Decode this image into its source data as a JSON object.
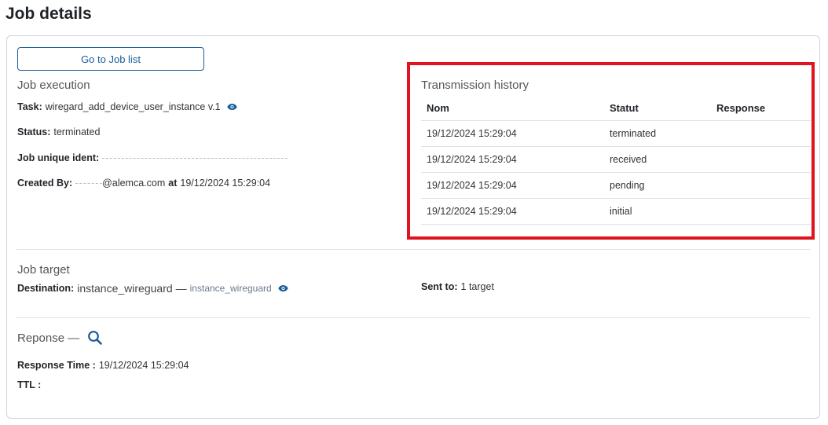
{
  "page": {
    "title": "Job details"
  },
  "toolbar": {
    "job_list_button": "Go to Job list"
  },
  "execution": {
    "title": "Job execution",
    "task_label": "Task:",
    "task_value": "wiregard_add_device_user_instance v.1",
    "status_label": "Status:",
    "status_value": "terminated",
    "ident_label": "Job unique ident:",
    "created_label": "Created By:",
    "created_email": "@alemca.com",
    "created_at_label": "at",
    "created_at_value": "19/12/2024 15:29:04"
  },
  "history": {
    "title": "Transmission history",
    "columns": [
      "Nom",
      "Statut",
      "Response"
    ],
    "rows": [
      {
        "date": "19/12/2024 15:29:04",
        "status": "terminated",
        "response": ""
      },
      {
        "date": "19/12/2024 15:29:04",
        "status": "received",
        "response": ""
      },
      {
        "date": "19/12/2024 15:29:04",
        "status": "pending",
        "response": ""
      },
      {
        "date": "19/12/2024 15:29:04",
        "status": "initial",
        "response": ""
      }
    ]
  },
  "target": {
    "title": "Job target",
    "destination_label": "Destination:",
    "destination_value": "instance_wireguard",
    "destination_separator": "—",
    "destination_sub": "instance_wireguard",
    "sent_to_label": "Sent to:",
    "sent_to_value": "1 target"
  },
  "response": {
    "title": "Reponse —",
    "time_label": "Response Time :",
    "time_value": "19/12/2024 15:29:04",
    "ttl_label": "TTL :"
  },
  "colors": {
    "accent": "#1b5d99",
    "highlight": "#e0141f"
  },
  "icons": {
    "view": "eye-icon",
    "search": "search-icon"
  }
}
